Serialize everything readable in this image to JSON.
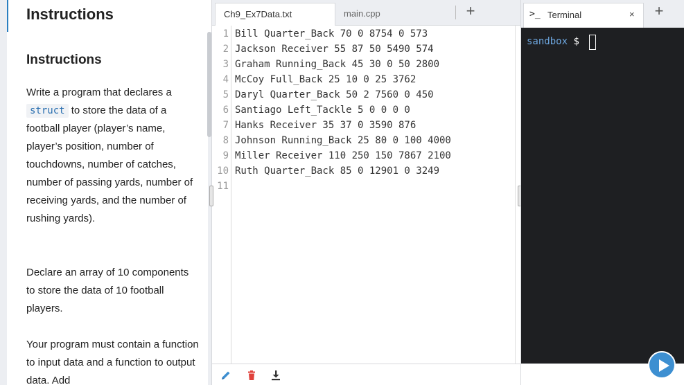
{
  "instructions": {
    "header_title": "Instructions",
    "heading": "Instructions",
    "p1_before": "Write a program that declares a",
    "p1_code": "struct",
    "p1_after": "to store the data of a football player (player’s name, player’s position, number of touchdowns, number of catches, number of passing yards, number of receiving yards, and the number of rushing yards).",
    "p2": "Declare an array of 10 components to store the data of 10 football players.",
    "p3": "Your program must contain a function to input data and a function to output data. Add"
  },
  "editor": {
    "tabs": [
      {
        "label": "Ch9_Ex7Data.txt",
        "active": true
      },
      {
        "label": "main.cpp",
        "active": false
      }
    ],
    "add_tab_label": "+",
    "line_numbers": [
      "1",
      "2",
      "3",
      "4",
      "5",
      "6",
      "7",
      "8",
      "9",
      "10",
      "11"
    ],
    "lines": [
      "Bill Quarter_Back 70 0 8754 0 573",
      "Jackson Receiver 55 87 50 5490 574",
      "Graham Running_Back 45 30 0 50 2800",
      "McCoy Full_Back 25 10 0 25 3762",
      "Daryl Quarter_Back 50 2 7560 0 450",
      "Santiago Left_Tackle 5 0 0 0 0",
      "Hanks Receiver 35 37 0 3590 876",
      "Johnson Running_Back 25 80 0 100 4000",
      "Miller Receiver 110 250 150 7867 2100",
      "Ruth Quarter_Back 85 0 12901 0 3249",
      ""
    ],
    "footer_icons": [
      "pencil-icon",
      "trash-icon",
      "download-icon"
    ]
  },
  "terminal": {
    "tab_icon": ">_",
    "tab_label": "Terminal",
    "close_label": "×",
    "add_label": "+",
    "prompt_host": "sandbox",
    "prompt_symbol": "$"
  },
  "colors": {
    "accent": "#2a7fc1",
    "terminal_bg": "#1e1f22",
    "prompt_host": "#6ea7e0",
    "run_button": "#3d8fd1",
    "trash": "#e0413b"
  }
}
